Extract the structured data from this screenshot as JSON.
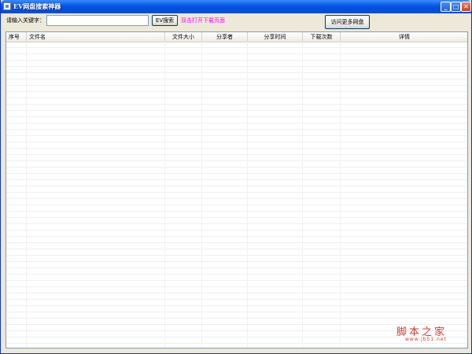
{
  "window": {
    "title": "EV网盘搜索神器"
  },
  "titlebar_buttons": {
    "minimize": "_",
    "maximize": "□",
    "close": "✕"
  },
  "toolbar": {
    "keyword_label": "请输入关键字：",
    "keyword_value": "",
    "search_button": "EV搜索",
    "hint": "双击打开下载页面",
    "visit_button": "访问更多网盘"
  },
  "table": {
    "columns": [
      "序号",
      "文件名",
      "文件大小",
      "分享者",
      "分享时间",
      "下载次数",
      "详情"
    ],
    "rows": []
  },
  "watermark": {
    "text": "脚本之家",
    "sub": "www.jb51.net"
  }
}
